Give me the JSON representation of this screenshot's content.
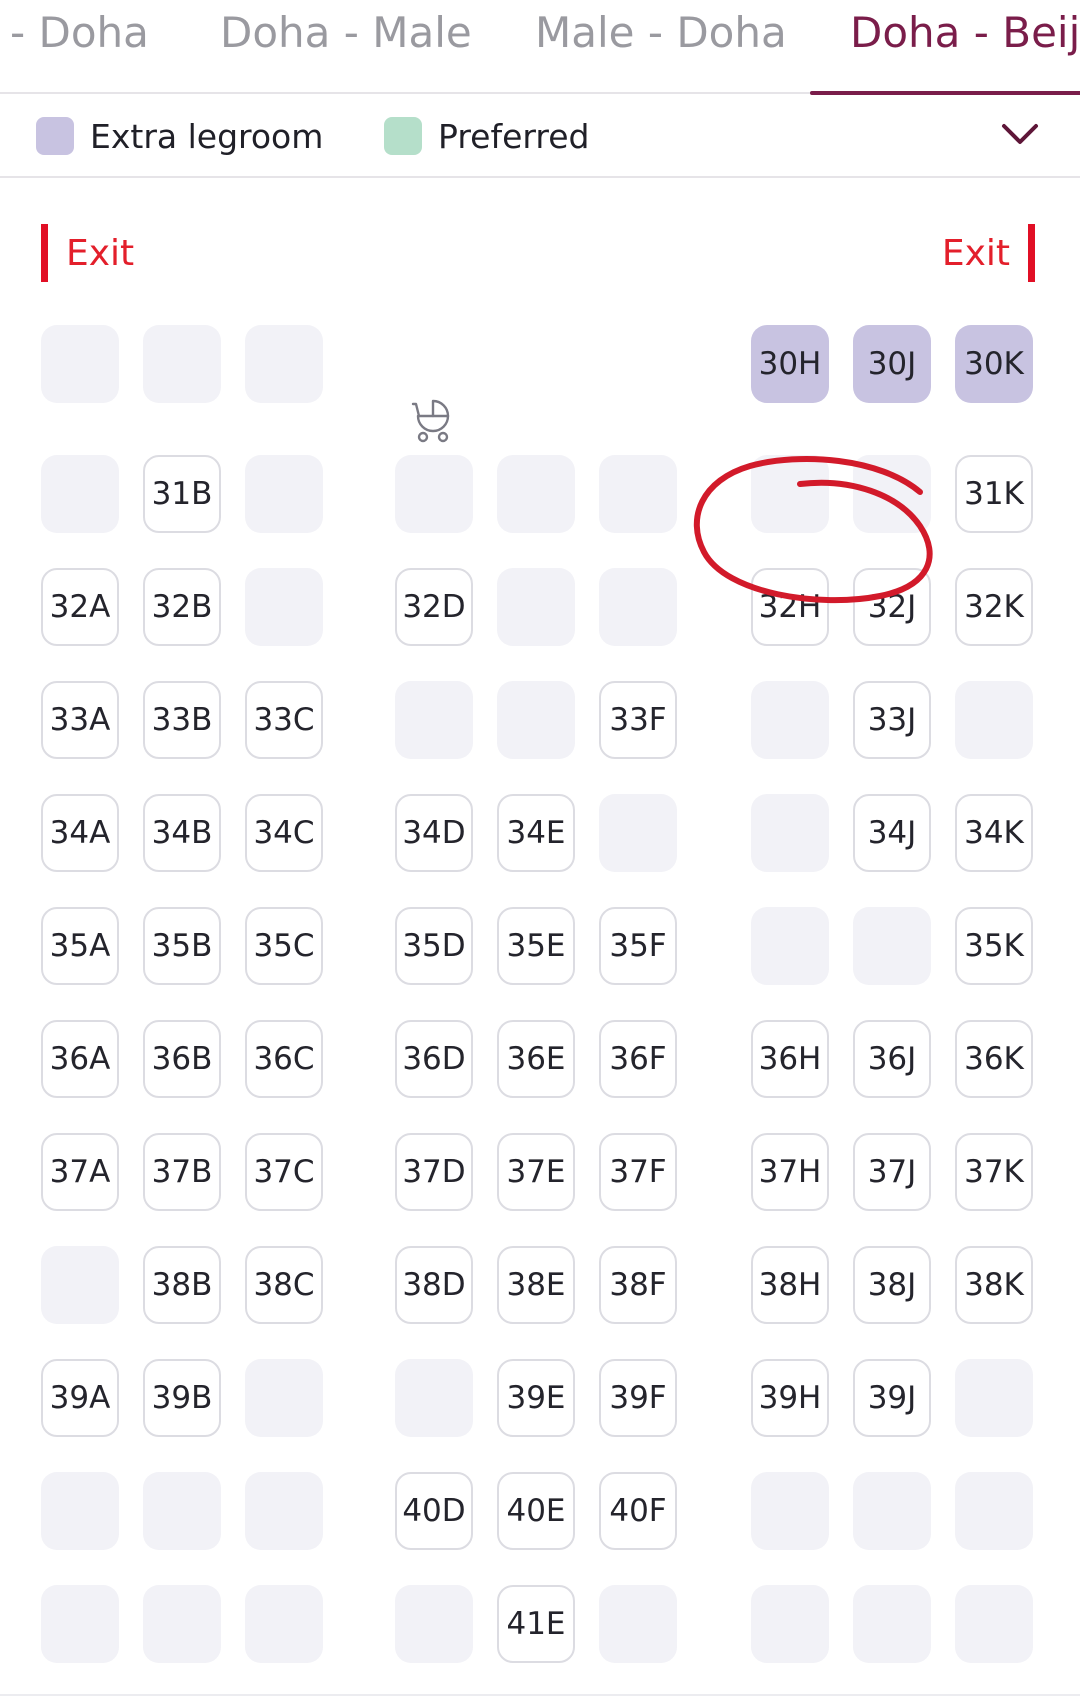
{
  "tabs": [
    {
      "label": "- Doha",
      "active": false
    },
    {
      "label": "Doha - Male",
      "active": false
    },
    {
      "label": "Male - Doha",
      "active": false
    },
    {
      "label": "Doha - Beijin",
      "active": true
    }
  ],
  "legend": {
    "extra_legroom": {
      "label": "Extra legroom",
      "color": "#c8c3e1"
    },
    "preferred": {
      "label": "Preferred",
      "color": "#b5dfca"
    },
    "toggle_icon": "chevron-down-icon"
  },
  "exits": {
    "left": "Exit",
    "right": "Exit",
    "color": "#e10f25"
  },
  "icons": {
    "stroller": "stroller-icon",
    "annotation": "hand-drawn-circle"
  },
  "seat_map": {
    "columns": [
      "A",
      "B",
      "C",
      "D",
      "E",
      "F",
      "H",
      "J",
      "K"
    ],
    "rows": [
      {
        "row": "30",
        "seats": [
          {
            "col": "A",
            "label": "",
            "state": "unavailable"
          },
          {
            "col": "B",
            "label": "",
            "state": "unavailable"
          },
          {
            "col": "C",
            "label": "",
            "state": "unavailable"
          },
          {
            "col": "H",
            "label": "30H",
            "state": "extra-legroom"
          },
          {
            "col": "J",
            "label": "30J",
            "state": "extra-legroom"
          },
          {
            "col": "K",
            "label": "30K",
            "state": "extra-legroom"
          }
        ]
      },
      {
        "row": "31",
        "seats": [
          {
            "col": "A",
            "label": "",
            "state": "unavailable"
          },
          {
            "col": "B",
            "label": "31B",
            "state": "available"
          },
          {
            "col": "C",
            "label": "",
            "state": "unavailable"
          },
          {
            "col": "D",
            "label": "",
            "state": "unavailable"
          },
          {
            "col": "E",
            "label": "",
            "state": "unavailable"
          },
          {
            "col": "F",
            "label": "",
            "state": "unavailable"
          },
          {
            "col": "H",
            "label": "",
            "state": "unavailable"
          },
          {
            "col": "J",
            "label": "",
            "state": "unavailable"
          },
          {
            "col": "K",
            "label": "31K",
            "state": "available"
          }
        ]
      },
      {
        "row": "32",
        "seats": [
          {
            "col": "A",
            "label": "32A",
            "state": "available"
          },
          {
            "col": "B",
            "label": "32B",
            "state": "available"
          },
          {
            "col": "C",
            "label": "",
            "state": "unavailable"
          },
          {
            "col": "D",
            "label": "32D",
            "state": "available"
          },
          {
            "col": "E",
            "label": "",
            "state": "unavailable"
          },
          {
            "col": "F",
            "label": "",
            "state": "unavailable"
          },
          {
            "col": "H",
            "label": "32H",
            "state": "available"
          },
          {
            "col": "J",
            "label": "32J",
            "state": "available"
          },
          {
            "col": "K",
            "label": "32K",
            "state": "available"
          }
        ]
      },
      {
        "row": "33",
        "seats": [
          {
            "col": "A",
            "label": "33A",
            "state": "available"
          },
          {
            "col": "B",
            "label": "33B",
            "state": "available"
          },
          {
            "col": "C",
            "label": "33C",
            "state": "available"
          },
          {
            "col": "D",
            "label": "",
            "state": "unavailable"
          },
          {
            "col": "E",
            "label": "",
            "state": "unavailable"
          },
          {
            "col": "F",
            "label": "33F",
            "state": "available"
          },
          {
            "col": "H",
            "label": "",
            "state": "unavailable"
          },
          {
            "col": "J",
            "label": "33J",
            "state": "available"
          },
          {
            "col": "K",
            "label": "",
            "state": "unavailable"
          }
        ]
      },
      {
        "row": "34",
        "seats": [
          {
            "col": "A",
            "label": "34A",
            "state": "available"
          },
          {
            "col": "B",
            "label": "34B",
            "state": "available"
          },
          {
            "col": "C",
            "label": "34C",
            "state": "available"
          },
          {
            "col": "D",
            "label": "34D",
            "state": "available"
          },
          {
            "col": "E",
            "label": "34E",
            "state": "available"
          },
          {
            "col": "F",
            "label": "",
            "state": "unavailable"
          },
          {
            "col": "H",
            "label": "",
            "state": "unavailable"
          },
          {
            "col": "J",
            "label": "34J",
            "state": "available"
          },
          {
            "col": "K",
            "label": "34K",
            "state": "available"
          }
        ]
      },
      {
        "row": "35",
        "seats": [
          {
            "col": "A",
            "label": "35A",
            "state": "available"
          },
          {
            "col": "B",
            "label": "35B",
            "state": "available"
          },
          {
            "col": "C",
            "label": "35C",
            "state": "available"
          },
          {
            "col": "D",
            "label": "35D",
            "state": "available"
          },
          {
            "col": "E",
            "label": "35E",
            "state": "available"
          },
          {
            "col": "F",
            "label": "35F",
            "state": "available"
          },
          {
            "col": "H",
            "label": "",
            "state": "unavailable"
          },
          {
            "col": "J",
            "label": "",
            "state": "unavailable"
          },
          {
            "col": "K",
            "label": "35K",
            "state": "available"
          }
        ]
      },
      {
        "row": "36",
        "seats": [
          {
            "col": "A",
            "label": "36A",
            "state": "available"
          },
          {
            "col": "B",
            "label": "36B",
            "state": "available"
          },
          {
            "col": "C",
            "label": "36C",
            "state": "available"
          },
          {
            "col": "D",
            "label": "36D",
            "state": "available"
          },
          {
            "col": "E",
            "label": "36E",
            "state": "available"
          },
          {
            "col": "F",
            "label": "36F",
            "state": "available"
          },
          {
            "col": "H",
            "label": "36H",
            "state": "available"
          },
          {
            "col": "J",
            "label": "36J",
            "state": "available"
          },
          {
            "col": "K",
            "label": "36K",
            "state": "available"
          }
        ]
      },
      {
        "row": "37",
        "seats": [
          {
            "col": "A",
            "label": "37A",
            "state": "available"
          },
          {
            "col": "B",
            "label": "37B",
            "state": "available"
          },
          {
            "col": "C",
            "label": "37C",
            "state": "available"
          },
          {
            "col": "D",
            "label": "37D",
            "state": "available"
          },
          {
            "col": "E",
            "label": "37E",
            "state": "available"
          },
          {
            "col": "F",
            "label": "37F",
            "state": "available"
          },
          {
            "col": "H",
            "label": "37H",
            "state": "available"
          },
          {
            "col": "J",
            "label": "37J",
            "state": "available"
          },
          {
            "col": "K",
            "label": "37K",
            "state": "available"
          }
        ]
      },
      {
        "row": "38",
        "seats": [
          {
            "col": "A",
            "label": "",
            "state": "unavailable"
          },
          {
            "col": "B",
            "label": "38B",
            "state": "available"
          },
          {
            "col": "C",
            "label": "38C",
            "state": "available"
          },
          {
            "col": "D",
            "label": "38D",
            "state": "available"
          },
          {
            "col": "E",
            "label": "38E",
            "state": "available"
          },
          {
            "col": "F",
            "label": "38F",
            "state": "available"
          },
          {
            "col": "H",
            "label": "38H",
            "state": "available"
          },
          {
            "col": "J",
            "label": "38J",
            "state": "available"
          },
          {
            "col": "K",
            "label": "38K",
            "state": "available"
          }
        ]
      },
      {
        "row": "39",
        "seats": [
          {
            "col": "A",
            "label": "39A",
            "state": "available"
          },
          {
            "col": "B",
            "label": "39B",
            "state": "available"
          },
          {
            "col": "C",
            "label": "",
            "state": "unavailable"
          },
          {
            "col": "D",
            "label": "",
            "state": "unavailable"
          },
          {
            "col": "E",
            "label": "39E",
            "state": "available"
          },
          {
            "col": "F",
            "label": "39F",
            "state": "available"
          },
          {
            "col": "H",
            "label": "39H",
            "state": "available"
          },
          {
            "col": "J",
            "label": "39J",
            "state": "available"
          },
          {
            "col": "K",
            "label": "",
            "state": "unavailable"
          }
        ]
      },
      {
        "row": "40",
        "seats": [
          {
            "col": "A",
            "label": "",
            "state": "unavailable"
          },
          {
            "col": "B",
            "label": "",
            "state": "unavailable"
          },
          {
            "col": "C",
            "label": "",
            "state": "unavailable"
          },
          {
            "col": "D",
            "label": "40D",
            "state": "available"
          },
          {
            "col": "E",
            "label": "40E",
            "state": "available"
          },
          {
            "col": "F",
            "label": "40F",
            "state": "available"
          },
          {
            "col": "H",
            "label": "",
            "state": "unavailable"
          },
          {
            "col": "J",
            "label": "",
            "state": "unavailable"
          },
          {
            "col": "K",
            "label": "",
            "state": "unavailable"
          }
        ]
      },
      {
        "row": "41",
        "seats": [
          {
            "col": "A",
            "label": "",
            "state": "unavailable"
          },
          {
            "col": "B",
            "label": "",
            "state": "unavailable"
          },
          {
            "col": "C",
            "label": "",
            "state": "unavailable"
          },
          {
            "col": "D",
            "label": "",
            "state": "unavailable"
          },
          {
            "col": "E",
            "label": "41E",
            "state": "available"
          },
          {
            "col": "F",
            "label": "",
            "state": "unavailable"
          },
          {
            "col": "H",
            "label": "",
            "state": "unavailable"
          },
          {
            "col": "J",
            "label": "",
            "state": "unavailable"
          },
          {
            "col": "K",
            "label": "",
            "state": "unavailable"
          }
        ]
      }
    ]
  }
}
